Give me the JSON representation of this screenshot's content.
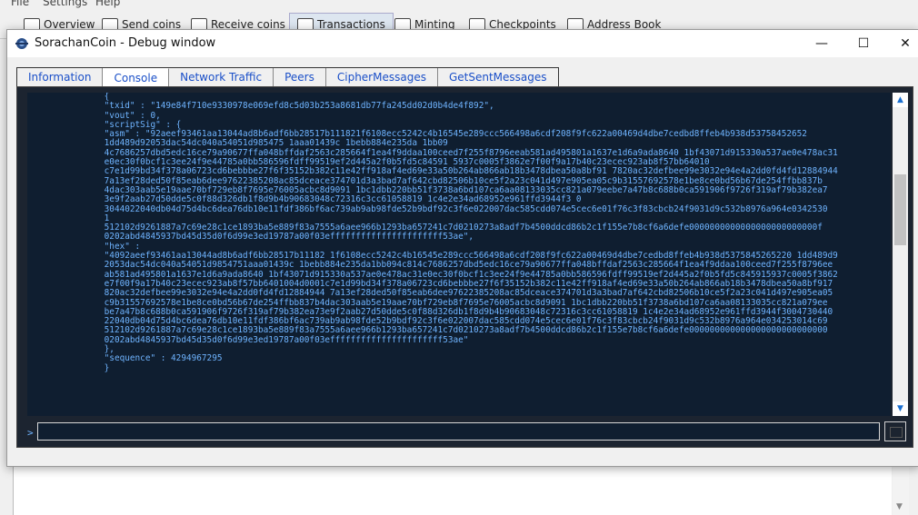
{
  "background_window": {
    "menu": [
      "File",
      "Settings",
      "Help"
    ],
    "toolbar_tabs": [
      {
        "label": "Overview",
        "active": false
      },
      {
        "label": "Send coins",
        "active": false
      },
      {
        "label": "Receive coins",
        "active": false
      },
      {
        "label": "Transactions",
        "active": true
      },
      {
        "label": "Minting",
        "active": false
      },
      {
        "label": "Checkpoints",
        "active": false
      },
      {
        "label": "Address Book",
        "active": false
      }
    ]
  },
  "debug_window": {
    "title": "SorachanCoin - Debug window",
    "controls": {
      "minimize": "—",
      "maximize": "☐",
      "close": "✕"
    },
    "tabs": [
      {
        "label": "Information",
        "active": false
      },
      {
        "label": "Console",
        "active": true
      },
      {
        "label": "Network Traffic",
        "active": false
      },
      {
        "label": "Peers",
        "active": false
      },
      {
        "label": "CipherMessages",
        "active": false
      },
      {
        "label": "GetSentMessages",
        "active": false
      }
    ],
    "console_lines": [
      "               {",
      "               \"txid\" : \"149e84f710e9330978e069efd8c5d03b253a8681db77fa245dd02d0b4de4f892\",",
      "               \"vout\" : 0,",
      "               \"scriptSig\" : {",
      "               \"asm\" : \"92aeef93461aa13044ad8b6adf6bb28517b111821f6108ecc5242c4b16545e289ccc566498a6cdf208f9fc622a00469d4dbe7cedbd8ffeb4b938d53758452652",
      "               1dd489d92053dac54dc040a54051d985475 1aaa01439c 1bebb884e235da 1bb09",
      "               4c7686257dbd5edc16ce79a90677ffa048bffdaf2563c285664f1ea4f9ddaa100ceed7f255f8796eeab581ad495801a1637e1d6a9ada8640 1bf43071d915330a537ae0e478ac31",
      "               e0ec30f0bcf1c3ee24f9e44785a0bb586596fdff99519ef2d445a2f0b5fd5c84591 5937c0005f3862e7f00f9a17b40c23ecec923ab8f57bb64010",
      "               c7e1d99bd34f378a06723cd6bebbbe27f6f35152b382c11e42ff918af4ed69e33a50b264ab866ab18b3478dbea50a8bf91 7820ac32defbee99e3032e94e4a2dd0fd4fd12884944",
      "               7a13ef28ded50f85eab6dee97622385208ac85dceace374701d3a3bad7af642cbd82506b10ce5f2a23c041d497e905ea05c9b31557692578e1be8ce0bd56b67de254ffbb837b",
      "               4dac303aab5e19aae70bf729eb8f7695e76005acbc8d9091 1bc1dbb220bb51f3738a6bd107ca6aa08133035cc821a079eebe7a47b8c688b0ca591906f9726f319af79b382ea7",
      "               3e9f2aab27d50dde5c0f88d326db1f8d9b4b90683048c72316c3cc61058819 1c4e2e34ad68952e961ffd3944f3 0",
      "               3044022040db04d75d4bc6dea76db10e11fdf386bf6ac739ab9ab98fde52b9bdf92c3f6e022007dac585cdd074e5cec6e01f76c3f83cbcb24f9031d9c532b8976a964e0342530",
      "               1",
      "               512102d9261887a7c69e28c1ce1893ba5e889f83a7555a6aee966b1293ba657241c7d0210273a8adf7b4500ddcd86b2c1f155e7b8cf6a6defe0000000000000000000000000f",
      "               0202abd4845937bd45d35d0f6d99e3ed19787a00f03effffffffffffffffffffff53ae\",",
      "               \"hex\" :",
      "               \"4092aeef93461aa13044ad8b6adf6bb28517b11182 1f6108ecc5242c4b16545e289ccc566498a6cdf208f9fc622a00469d4dbe7cedbd8ffeb4b938d5375845265220 1dd489d9",
      "               2053dac54dc040a54051d9854751aaa01439c 1bebb884e235da1bb094c814c7686257dbd5edc16ce79a90677ffa048bffdaf2563c285664f1ea4f9ddaa100ceed7f255f8796ee",
      "               ab581ad495801a1637e1d6a9ada8640 1bf43071d915330a537ae0e478ac31e0ec30f0bcf1c3ee24f9e44785a0bb586596fdff99519ef2d445a2f0b5fd5c845915937c0005f3862",
      "               e7f00f9a17b40c23ecec923ab8f57bb6401004d0001c7e1d99bd34f378a06723cd6bebbbe27f6f35152b382c11e42ff918af4ed69e33a50b264ab866ab18b3478dbea50a8bf917",
      "               820ac32defbee99e3032e94e4a2dd0fd4fd12884944 7a13ef28ded50f85eab6dee97622385208ac85dceace374701d3a3bad7af642cbd82506b10ce5f2a23c041d497e905ea05",
      "               c9b31557692578e1be8ce0bd56b67de254ffbb837b4dac303aab5e19aae70bf729eb8f7695e76005acbc8d9091 1bc1dbb220bb51f3738a6bd107ca6aa08133035cc821a079ee",
      "               be7a47b8c688b0ca591906f9726f319af79b382ea73e9f2aab27d50dde5c0f88d326db1f8d9b4b90683048c72316c3cc61058819 1c4e2e34ad68952e961ffd3944f3004730440",
      "               22040db04d75d4bc6dea76db10e11fdf386bf6ac739ab9ab98fde52b9bdf92c3f6e022007dac585cdd074e5cec6e01f76c3f83cbcb24f9031d9c532b8976a964e034253014c69",
      "               512102d9261887a7c69e28c1ce1893ba5e889f83a7555a6aee966b1293ba657241c7d0210273a8adf7b4500ddcd86b2c1f155e7b8cf6a6defe000000000000000000000000000",
      "               0202abd4845937bd45d35d0f6d99e3ed19787a00f03effffffffffffffffffffff53ae\"",
      "               },",
      "               \"sequence\" : 4294967295",
      "               }"
    ],
    "console_input_value": ""
  }
}
